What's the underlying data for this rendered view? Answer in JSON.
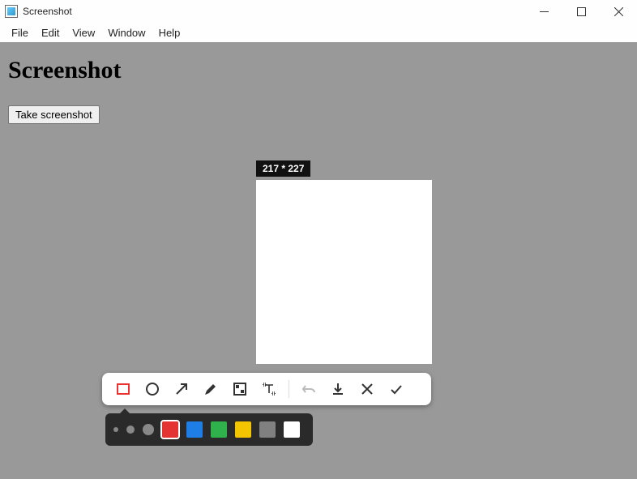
{
  "window": {
    "title": "Screenshot",
    "controls": {
      "minimize": "minimize",
      "maximize": "maximize",
      "close": "close"
    }
  },
  "menu": {
    "items": [
      "File",
      "Edit",
      "View",
      "Window",
      "Help"
    ]
  },
  "page": {
    "heading": "Screenshot",
    "take_button": "Take screenshot"
  },
  "capture": {
    "size_label": "217 * 227"
  },
  "toolbar": {
    "tools": {
      "rectangle": "rectangle-icon",
      "ellipse": "ellipse-icon",
      "arrow": "arrow-icon",
      "pen": "pen-icon",
      "mosaic": "mosaic-icon",
      "text": "text-icon"
    },
    "actions": {
      "undo": "undo-icon",
      "download": "download-icon",
      "cancel": "close-icon",
      "confirm": "check-icon"
    }
  },
  "options": {
    "sizes": [
      "small",
      "medium",
      "large"
    ],
    "colors": [
      "#e33333",
      "#1e7ee6",
      "#2fb24c",
      "#f3c500",
      "#808080",
      "#ffffff"
    ],
    "selected_color": "#e33333"
  }
}
